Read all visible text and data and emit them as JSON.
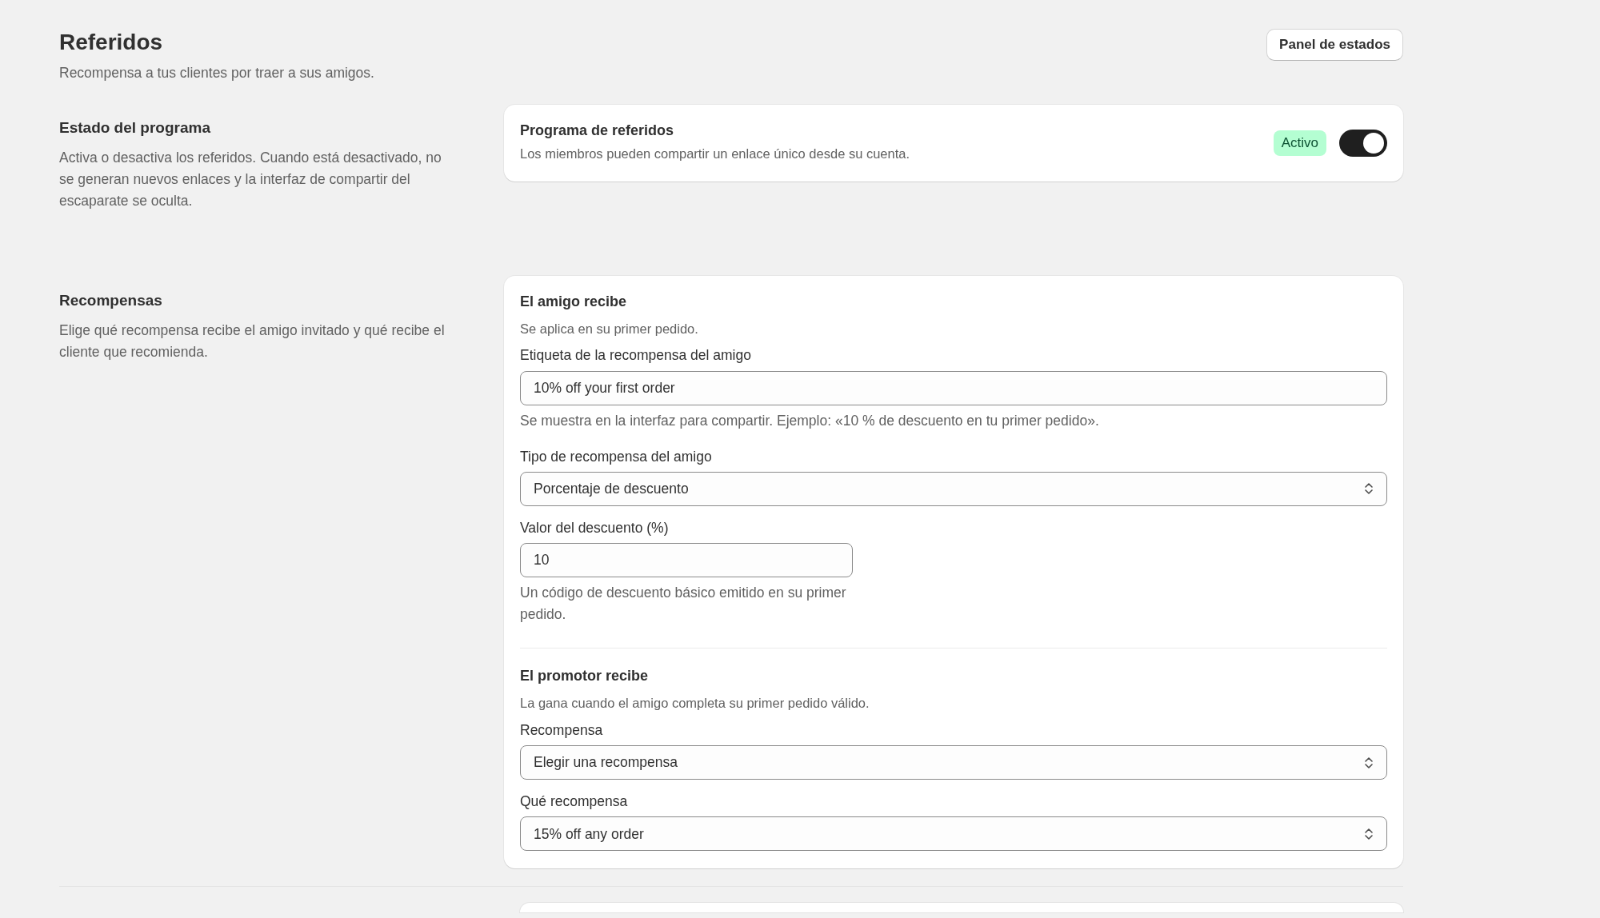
{
  "header": {
    "title": "Referidos",
    "subtitle": "Recompensa a tus clientes por traer a sus amigos.",
    "button": "Panel de estados"
  },
  "sections": [
    {
      "title": "Estado del programa",
      "description": "Activa o desactiva los referidos. Cuando está desactivado, no se generan nuevos enlaces y la interfaz de compartir del escaparate se oculta.",
      "card": {
        "kind": "toggle",
        "title": "Programa de referidos",
        "description": "Los miembros pueden compartir un enlace único desde su cuenta.",
        "badge": "Activo",
        "on": true
      }
    },
    {
      "title": "Recompensas",
      "description": "Elige qué recompensa recibe el amigo invitado y qué recibe el cliente que recomienda.",
      "card": {
        "kind": "form",
        "groups": [
          {
            "title": "El amigo recibe",
            "description": "Se aplica en su primer pedido.",
            "fields": [
              {
                "kind": "text",
                "label": "Etiqueta de la recompensa del amigo",
                "value": "10% off your first order",
                "help": "Se muestra en la interfaz para compartir. Ejemplo: «10 % de descuento en tu primer pedido»."
              },
              {
                "kind": "select",
                "label": "Tipo de recompensa del amigo",
                "value": "Porcentaje de descuento"
              },
              {
                "kind": "short-text",
                "label": "Valor del descuento (%)",
                "value": "10",
                "help": "Un código de descuento básico emitido en su primer pedido."
              }
            ]
          },
          {
            "title": "El promotor recibe",
            "description": "La gana cuando el amigo completa su primer pedido válido.",
            "fields": [
              {
                "kind": "select",
                "label": "Recompensa",
                "value": "Elegir una recompensa"
              },
              {
                "kind": "select",
                "label": "Qué recompensa",
                "value": "15% off any order"
              }
            ]
          }
        ]
      }
    }
  ]
}
